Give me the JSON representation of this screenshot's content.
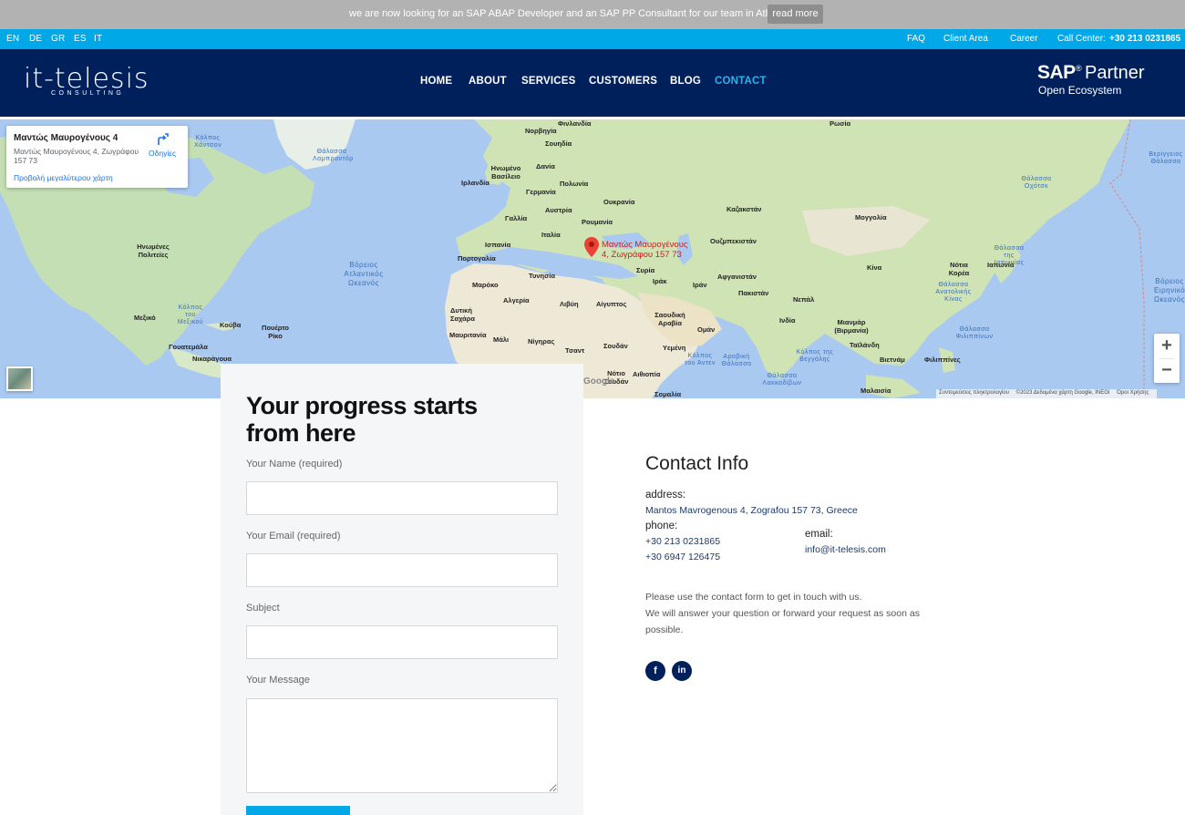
{
  "announcement": {
    "text": "we are now looking for an SAP ABAP Developer and an SAP PP Consultant for our team in Athens",
    "button": "read more"
  },
  "topbar": {
    "languages": [
      "EN",
      "DE",
      "GR",
      "ES",
      "IT"
    ],
    "faq": "FAQ",
    "client_area": "Client Area",
    "career": "Career",
    "call_center_label": "Call Center:",
    "call_center_number": "+30 213 0231865"
  },
  "logo": {
    "main": "it-telesis",
    "sub": "CONSULTING"
  },
  "nav": {
    "items": [
      "HOME",
      "ABOUT",
      "SERVICES",
      "CUSTOMERS",
      "BLOG",
      "CONTACT"
    ],
    "active": "CONTACT"
  },
  "sap": {
    "brand": "SAP",
    "reg": "®",
    "partner": "Partner",
    "ecosystem": "Open Ecosystem"
  },
  "map": {
    "card_title": "Μαντώς Μαυρογένους 4",
    "card_address": "Μαντώς Μαυρογένους 4, Ζωγράφου 157 73",
    "card_link": "Προβολή μεγαλύτερου χάρτη",
    "directions": "Οδηγίες",
    "pin_label_1": "Μαντώς Μαυρογένους",
    "pin_label_2": "4, Ζωγράφου 157 73",
    "zoom_in": "+",
    "zoom_out": "−",
    "attribution": [
      "Συντομεύσεις πληκτρολογίου",
      "©2023 Δεδομένα χάρτη Google, INEGI",
      "Όροι Χρήσης"
    ],
    "google": "Google",
    "labels": {
      "finland": "Φινλανδία",
      "russia": "Ρωσία",
      "norway": "Νορβηγία",
      "sweden": "Σουηδία",
      "denmark": "Δανία",
      "uk": "Ηνωμένο Βασίλειο",
      "ireland": "Ιρλανδία",
      "germany": "Γερμανία",
      "poland": "Πολωνία",
      "ukraine": "Ουκρανία",
      "kazakhstan": "Καζακστάν",
      "mongolia": "Μογγολία",
      "france": "Γαλλία",
      "austria": "Αυστρία",
      "romania": "Ρουμανία",
      "italy": "Ιταλία",
      "uzbekistan": "Ουζμπεκιστάν",
      "spain": "Ισπανία",
      "portugal": "Πορτογαλία",
      "tunisia": "Τυνησία",
      "syria": "Συρία",
      "iraq": "Ιράκ",
      "iran": "Ιράν",
      "afghanistan": "Αφγανιστάν",
      "china": "Κίνα",
      "southkorea": "Νότια Κορέα",
      "japan": "Ιαπωνία",
      "morocco": "Μαρόκο",
      "algeria": "Αλγερία",
      "libya": "Λιβύη",
      "egypt": "Αίγυπτος",
      "pakistan": "Πακιστάν",
      "nepal": "Νεπάλ",
      "india": "Ινδία",
      "saudi": "Σαουδική Αραβία",
      "oman": "Ομάν",
      "wsahara": "Δυτική Σαχάρα",
      "mauritania": "Μαυριτανία",
      "mali": "Μάλι",
      "niger": "Νίγηρας",
      "chad": "Τσαντ",
      "sudan": "Σουδάν",
      "yemen": "Υεμένη",
      "myanmar": "Μιανμάρ (Βιρμανία)",
      "thailand": "Ταϊλάνδη",
      "vietnam": "Βιετνάμ",
      "philippines": "Φιλιππίνες",
      "southsudan": "Νότιο Σουδάν",
      "ethiopia": "Αιθιοπία",
      "somalia": "Σομαλία",
      "malaysia": "Μαλαισία",
      "usa": "Ηνωμένες Πολιτείες",
      "mexico": "Μεξικό",
      "cuba": "Κούβα",
      "puertorico": "Πουέρτο Ρίκο",
      "guatemala": "Γουατεμάλα",
      "nicaragua": "Νικαράγουα",
      "atlantic": "Βόρειος Ατλαντικός Ωκεανός",
      "labrador": "Θάλασσα Λαμπραντόρ",
      "hudson": "Κόλπος Χάντσον",
      "mexgulf": "Κόλπος του Μεξικού",
      "japansea": "Θάλασσα της Ιαπωνίας",
      "okhotsk": "Θάλασσα Οχότσκ",
      "bering": "Βερίγγειος Θάλασσα",
      "eastchina": "Θάλασσα Ανατολικής Κίνας",
      "philsea": "Θάλασσα Φιλιππίνων",
      "bengal": "Κόλπος της Βεγγάλης",
      "arabian": "Αραβική Θάλασσα",
      "aden": "Κόλπος του Άντεν",
      "laccadive": "Θάλασσα Λακκαδίβων",
      "pacific": "Βόρειος Ειρηνικός Ωκεανός"
    }
  },
  "form": {
    "title": "Your progress starts from here",
    "name_label": "Your Name (required)",
    "email_label": "Your Email (required)",
    "subject_label": "Subject",
    "message_label": "Your Message"
  },
  "contact": {
    "title": "Contact Info",
    "address_label": "address:",
    "address": "Mantos Mavrogenous 4, Zografou 157 73, Greece",
    "phone_label": "phone:",
    "phone1": "+30 213 0231865",
    "phone2": "+30 6947 126475",
    "email_label": "email:",
    "email": "info@it-telesis.com",
    "note1": "Please use the contact form to get in touch with us.",
    "note2": "We will answer your question or forward your request as soon as possible.",
    "facebook": "f",
    "linkedin": "in"
  },
  "colors": {
    "accent": "#00a8e8",
    "navy": "#00205b",
    "active_nav": "#2ab3ea"
  }
}
